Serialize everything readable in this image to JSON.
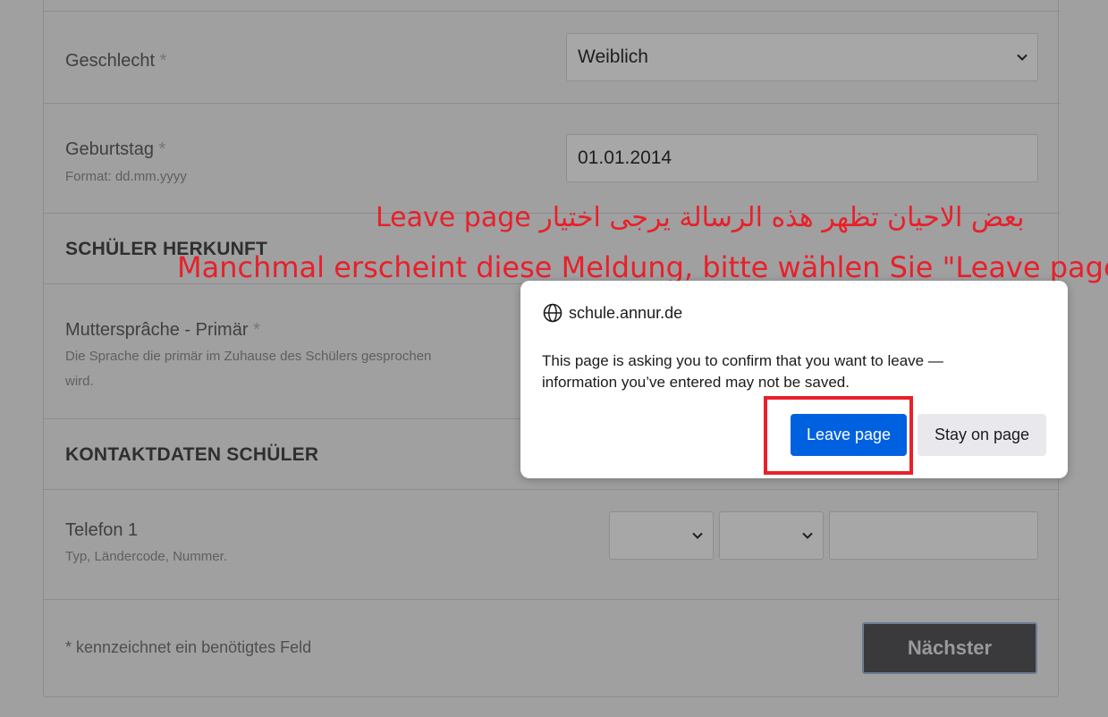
{
  "form": {
    "gender": {
      "label": "Geschlecht",
      "required_mark": "*",
      "value": "Weiblich"
    },
    "birthday": {
      "label": "Geburtstag",
      "required_mark": "*",
      "hint": "Format: dd.mm.yyyy",
      "value": "01.01.2014"
    },
    "section_origin": "SCHÜLER HERKUNFT",
    "mother_tongue": {
      "label": "Muttersprâche - Primär",
      "required_mark": "*",
      "hint": "Die Sprache die primär im Zuhause des Schülers gesprochen wird."
    },
    "section_contact": "KONTAKTDATEN SCHÜLER",
    "phone": {
      "label": "Telefon 1",
      "hint": "Typ, Ländercode, Nummer.",
      "type_value": "",
      "country_value": "",
      "number_value": ""
    },
    "required_note": "* kennzeichnet ein benötigtes Feld",
    "next_label": "Nächster"
  },
  "annotations": {
    "arabic": "بعض الاحيان تظهر هذه الرسالة يرجى اختيار Leave page",
    "german": "Manchmal erscheint diese Meldung, bitte wählen Sie \"Leave page\""
  },
  "dialog": {
    "host": "schule.annur.de",
    "host_icon": "globe-icon",
    "message": "This page is asking you to confirm that you want to leave — information you’ve entered may not be saved.",
    "leave_label": "Leave page",
    "stay_label": "Stay on page"
  },
  "colors": {
    "overlay_bg": "#a0a0a1",
    "primary_button": "#0061e0",
    "annotation": "#e8202a"
  }
}
